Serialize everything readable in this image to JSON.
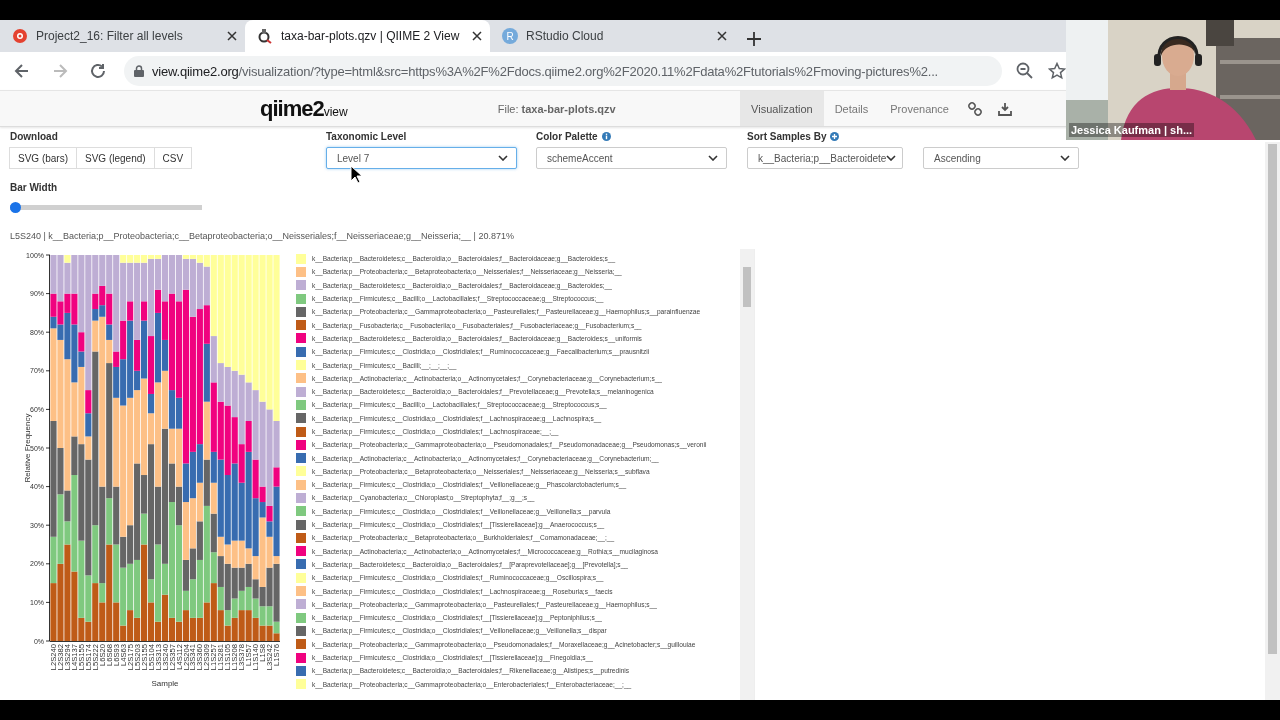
{
  "browser": {
    "tabs": [
      {
        "title": "Project2_16: Filter all levels",
        "kind": "canvas",
        "selected": false
      },
      {
        "title": "taxa-bar-plots.qzv | QIIME 2 View",
        "kind": "qiime",
        "selected": true
      },
      {
        "title": "RStudio Cloud",
        "kind": "letter",
        "icon_text": "R",
        "selected": false
      }
    ],
    "nav_buttons": [
      {
        "kind": "back",
        "disabled": false
      },
      {
        "kind": "forward",
        "disabled": true
      },
      {
        "kind": "reload",
        "disabled": false
      }
    ],
    "address": {
      "host": "view.qiime2.org",
      "path": "/visualization/?type=html&src=https%3A%2F%2Fdocs.qiime2.org%2F2020.11%2Fdata%2Ftutorials%2Fmoving-pictures%2..."
    }
  },
  "header": {
    "logo": "qiime2",
    "logo_suffix": "view",
    "file": "File: **taxa-bar-plots.qzv**",
    "tabs": [
      {
        "label": "Visualization",
        "selected": true
      },
      {
        "label": "Details",
        "selected": false
      },
      {
        "label": "Provenance",
        "selected": false
      }
    ]
  },
  "controls": {
    "download": {
      "label": "Download",
      "buttons": [
        "SVG (bars)",
        "SVG (legend)",
        "CSV"
      ]
    },
    "taxonomic_level": {
      "label": "Taxonomic Level",
      "value": "Level 7",
      "focused": true
    },
    "color_palette": {
      "label": "Color Palette",
      "value": "schemeAccent",
      "focused": false
    },
    "sort_samples": {
      "label": "Sort Samples By",
      "value": "k__Bacteria;p__Bacteroidete",
      "focused": false
    },
    "sort_order": {
      "value": "Ascending",
      "focused": false
    },
    "bar_width": {
      "label": "Bar Width",
      "level": 0
    }
  },
  "hover_info": "L5S240 | k__Bacteria;p__Proteobacteria;c__Betaproteobacteria;o__Neisseriales;f__Neisseriaceae;g__Neisseria;__ | 20.871%",
  "chart": {
    "chart_data": {
      "type": "bar",
      "stacked": true,
      "orientation": "vertical",
      "xlabel": "Sample",
      "ylabel": "Relative Frequency",
      "ylim": [
        0,
        100
      ],
      "yticks": [
        {
          "value": 0,
          "label": "0%"
        },
        {
          "value": 10,
          "label": "10%"
        },
        {
          "value": 20,
          "label": "20%"
        },
        {
          "value": 30,
          "label": "30%"
        },
        {
          "value": 40,
          "label": "40%"
        },
        {
          "value": 50,
          "label": "50%"
        },
        {
          "value": 60,
          "label": "60%"
        },
        {
          "value": 70,
          "label": "70%"
        },
        {
          "value": 80,
          "label": "80%"
        },
        {
          "value": 90,
          "label": "90%"
        },
        {
          "value": 100,
          "label": "100%"
        }
      ],
      "categories": [
        "L2S240",
        "L2S382",
        "L3S294",
        "L4S137",
        "L5S155",
        "L5S174",
        "L5S222",
        "L6S20",
        "L6S68",
        "L6S93",
        "L4S63",
        "L2S175",
        "L5S203",
        "L2S155",
        "L5S104",
        "L3S313",
        "L3S240",
        "L2S357",
        "L4S112",
        "L2S204",
        "L3S341",
        "L3S360",
        "L2S309",
        "L1S257",
        "L1S281",
        "L1S105",
        "L1S208",
        "L3S378",
        "L1S57",
        "L1S140",
        "L1S8",
        "L3S242",
        "L1S76"
      ],
      "series": [
        {
          "color": "#bf5b17",
          "values": [
            15,
            20,
            25,
            18,
            6,
            5,
            15,
            10,
            25,
            10,
            4,
            8,
            6,
            25,
            10,
            5,
            12,
            6,
            5,
            8,
            6,
            6,
            10,
            15,
            8,
            4,
            6,
            8,
            8,
            6,
            4,
            4,
            2
          ]
        },
        {
          "color": "#7fc97f",
          "values": [
            12,
            18,
            6,
            25,
            20,
            12,
            15,
            5,
            12,
            15,
            15,
            12,
            15,
            8,
            6,
            20,
            8,
            30,
            25,
            5,
            10,
            15,
            25,
            8,
            6,
            4,
            5,
            5,
            6,
            5,
            5,
            5,
            3
          ]
        },
        {
          "color": "#666666",
          "values": [
            30,
            12,
            8,
            10,
            25,
            30,
            45,
            25,
            35,
            15,
            8,
            10,
            25,
            10,
            35,
            15,
            35,
            10,
            10,
            8,
            8,
            10,
            12,
            10,
            8,
            12,
            8,
            6,
            6,
            5,
            5,
            10,
            15
          ]
        },
        {
          "color": "#fdc086",
          "values": [
            24,
            28,
            34,
            14,
            20,
            6,
            8,
            44,
            6,
            23,
            34,
            33,
            19,
            25,
            8,
            27,
            15,
            9,
            15,
            15,
            13,
            10,
            15,
            8,
            5,
            5,
            7,
            7,
            4,
            6,
            18,
            8,
            2
          ]
        },
        {
          "color": "#386cb0",
          "values": [
            3,
            4,
            12,
            15,
            4,
            6,
            3,
            3,
            4,
            8,
            12,
            20,
            5,
            15,
            5,
            18,
            8,
            10,
            8,
            10,
            12,
            10,
            15,
            8,
            20,
            18,
            20,
            15,
            25,
            15,
            4,
            4,
            18
          ]
        },
        {
          "color": "#f0027f",
          "values": [
            6,
            6,
            5,
            8,
            5,
            6,
            4,
            5,
            8,
            4,
            10,
            5,
            8,
            5,
            15,
            6,
            10,
            25,
            25,
            45,
            35,
            35,
            10,
            18,
            15,
            18,
            12,
            10,
            8,
            10,
            4,
            4,
            5
          ]
        },
        {
          "color": "#beaed4",
          "values": [
            10,
            12,
            8,
            10,
            20,
            35,
            10,
            8,
            10,
            25,
            15,
            10,
            20,
            10,
            20,
            8,
            12,
            10,
            12,
            8,
            15,
            12,
            10,
            12,
            10,
            10,
            12,
            18,
            10,
            18,
            22,
            25,
            12
          ]
        },
        {
          "color": "#ffff99",
          "values": [
            0,
            0,
            2,
            0,
            0,
            0,
            0,
            0,
            0,
            0,
            2,
            2,
            2,
            2,
            1,
            1,
            0,
            0,
            0,
            1,
            1,
            2,
            3,
            21,
            28,
            29,
            30,
            31,
            33,
            35,
            38,
            40,
            43
          ]
        }
      ]
    }
  },
  "legend": [
    {
      "label": "k__Bacteria;p__Bacteroidetes;c__Bacteroidia;o__Bacteroidales;f__Bacteroidaceae;g__Bacteroides;s__",
      "color": "#ffff99"
    },
    {
      "label": "k__Bacteria;p__Proteobacteria;c__Betaproteobacteria;o__Neisseriales;f__Neisseriaceae;g__Neisseria;__",
      "color": "#fdc086"
    },
    {
      "label": "k__Bacteria;p__Bacteroidetes;c__Bacteroidia;o__Bacteroidales;f__Bacteroidaceae;g__Bacteroides;__",
      "color": "#beaed4"
    },
    {
      "label": "k__Bacteria;p__Firmicutes;c__Bacilli;o__Lactobacillales;f__Streptococcaceae;g__Streptococcus;__",
      "color": "#7fc97f"
    },
    {
      "label": "k__Bacteria;p__Proteobacteria;c__Gammaproteobacteria;o__Pasteurellales;f__Pasteurellaceae;g__Haemophilus;s__parainfluenzae",
      "color": "#666666"
    },
    {
      "label": "k__Bacteria;p__Fusobacteria;c__Fusobacteriia;o__Fusobacteriales;f__Fusobacteriaceae;g__Fusobacterium;s__",
      "color": "#bf5b17"
    },
    {
      "label": "k__Bacteria;p__Bacteroidetes;c__Bacteroidia;o__Bacteroidales;f__Bacteroidaceae;g__Bacteroides;s__uniformis",
      "color": "#f0027f"
    },
    {
      "label": "k__Bacteria;p__Firmicutes;c__Clostridia;o__Clostridiales;f__Ruminococcaceae;g__Faecalibacterium;s__prausnitzii",
      "color": "#386cb0"
    },
    {
      "label": "k__Bacteria;p__Firmicutes;c__Bacilli;__;__;__;__",
      "color": "#ffff99"
    },
    {
      "label": "k__Bacteria;p__Actinobacteria;c__Actinobacteria;o__Actinomycetales;f__Corynebacteriaceae;g__Corynebacterium;s__",
      "color": "#fdc086"
    },
    {
      "label": "k__Bacteria;p__Bacteroidetes;c__Bacteroidia;o__Bacteroidales;f__Prevotellaceae;g__Prevotella;s__melaninogenica",
      "color": "#beaed4"
    },
    {
      "label": "k__Bacteria;p__Firmicutes;c__Bacilli;o__Lactobacillales;f__Streptococcaceae;g__Streptococcus;s__",
      "color": "#7fc97f"
    },
    {
      "label": "k__Bacteria;p__Firmicutes;c__Clostridia;o__Clostridiales;f__Lachnospiraceae;g__Lachnospira;s__",
      "color": "#666666"
    },
    {
      "label": "k__Bacteria;p__Firmicutes;c__Clostridia;o__Clostridiales;f__Lachnospiraceae;__;__",
      "color": "#bf5b17"
    },
    {
      "label": "k__Bacteria;p__Proteobacteria;c__Gammaproteobacteria;o__Pseudomonadales;f__Pseudomonadaceae;g__Pseudomonas;s__veronii",
      "color": "#f0027f"
    },
    {
      "label": "k__Bacteria;p__Actinobacteria;c__Actinobacteria;o__Actinomycetales;f__Corynebacteriaceae;g__Corynebacterium;__",
      "color": "#386cb0"
    },
    {
      "label": "k__Bacteria;p__Proteobacteria;c__Betaproteobacteria;o__Neisseriales;f__Neisseriaceae;g__Neisseria;s__subflava",
      "color": "#ffff99"
    },
    {
      "label": "k__Bacteria;p__Firmicutes;c__Clostridia;o__Clostridiales;f__Veillonellaceae;g__Phascolarctobacterium;s__",
      "color": "#fdc086"
    },
    {
      "label": "k__Bacteria;p__Cyanobacteria;c__Chloroplast;o__Streptophyta;f__;g__;s__",
      "color": "#beaed4"
    },
    {
      "label": "k__Bacteria;p__Firmicutes;c__Clostridia;o__Clostridiales;f__Veillonellaceae;g__Veillonella;s__parvula",
      "color": "#7fc97f"
    },
    {
      "label": "k__Bacteria;p__Firmicutes;c__Clostridia;o__Clostridiales;f__[Tissierellaceae];g__Anaerococcus;s__",
      "color": "#666666"
    },
    {
      "label": "k__Bacteria;p__Proteobacteria;c__Betaproteobacteria;o__Burkholderiales;f__Comamonadaceae;__;__",
      "color": "#bf5b17"
    },
    {
      "label": "k__Bacteria;p__Actinobacteria;c__Actinobacteria;o__Actinomycetales;f__Micrococcaceae;g__Rothia;s__mucilaginosa",
      "color": "#f0027f"
    },
    {
      "label": "k__Bacteria;p__Bacteroidetes;c__Bacteroidia;o__Bacteroidales;f__[Paraprevotellaceae];g__[Prevotella];s__",
      "color": "#386cb0"
    },
    {
      "label": "k__Bacteria;p__Firmicutes;c__Clostridia;o__Clostridiales;f__Ruminococcaceae;g__Oscillospira;s__",
      "color": "#ffff99"
    },
    {
      "label": "k__Bacteria;p__Firmicutes;c__Clostridia;o__Clostridiales;f__Lachnospiraceae;g__Roseburia;s__faecis",
      "color": "#fdc086"
    },
    {
      "label": "k__Bacteria;p__Proteobacteria;c__Gammaproteobacteria;o__Pasteurellales;f__Pasteurellaceae;g__Haemophilus;s__",
      "color": "#beaed4"
    },
    {
      "label": "k__Bacteria;p__Firmicutes;c__Clostridia;o__Clostridiales;f__[Tissierellaceae];g__Peptoniphilus;s__",
      "color": "#7fc97f"
    },
    {
      "label": "k__Bacteria;p__Firmicutes;c__Clostridia;o__Clostridiales;f__Veillonellaceae;g__Veillonella;s__dispar",
      "color": "#666666"
    },
    {
      "label": "k__Bacteria;p__Proteobacteria;c__Gammaproteobacteria;o__Pseudomonadales;f__Moraxellaceae;g__Acinetobacter;s__guillouiae",
      "color": "#bf5b17"
    },
    {
      "label": "k__Bacteria;p__Firmicutes;c__Clostridia;o__Clostridiales;f__[Tissierellaceae];g__Finegoldia;s__",
      "color": "#f0027f"
    },
    {
      "label": "k__Bacteria;p__Bacteroidetes;c__Bacteroidia;o__Bacteroidales;f__Rikenellaceae;g__Alistipes;s__putredinis",
      "color": "#386cb0"
    },
    {
      "label": "k__Bacteria;p__Proteobacteria;c__Gammaproteobacteria;o__Enterobacteriales;f__Enterobacteriaceae;__;__",
      "color": "#ffff99"
    }
  ],
  "webcam": {
    "kind": "picture",
    "caption": "Jessica Kaufman | sh..."
  }
}
